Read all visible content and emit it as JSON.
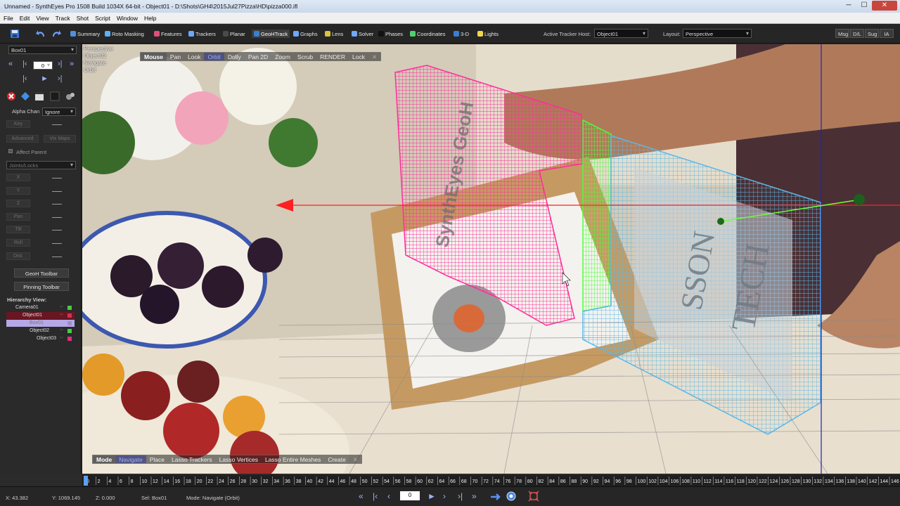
{
  "window": {
    "title": "Unnamed - SynthEyes Pro 1508 Build 1034X 64-bit - Object01 - D:\\Shots\\GH4\\2015Jul27Pizza\\HD\\pizza000.ifl",
    "minimize": "─",
    "maximize": "☐",
    "close": "✕"
  },
  "menu": [
    "File",
    "Edit",
    "View",
    "Track",
    "Shot",
    "Script",
    "Window",
    "Help"
  ],
  "toolbar": {
    "rooms": [
      {
        "label": "Summary",
        "icon": "summary-icon",
        "color": "#4f8fe0"
      },
      {
        "label": "Roto Masking",
        "icon": "roto-icon",
        "color": "#5bb0ff"
      },
      {
        "label": "Features",
        "icon": "features-icon",
        "color": "#e04f7a"
      },
      {
        "label": "Trackers",
        "icon": "trackers-icon",
        "color": "#6fa8ff"
      },
      {
        "label": "Planar",
        "icon": "planar-icon",
        "color": "#4a4a4a"
      },
      {
        "label": "GeoHTrack",
        "icon": "geohtrack-icon",
        "color": "#3a7fd0"
      },
      {
        "label": "Graphs",
        "icon": "graphs-icon",
        "color": "#6fa8ff"
      },
      {
        "label": "Lens",
        "icon": "lens-icon",
        "color": "#d9c43a"
      },
      {
        "label": "Solver",
        "icon": "solver-icon",
        "color": "#6fa8ff"
      },
      {
        "label": "Phases",
        "icon": "phases-icon",
        "color": "#111111"
      },
      {
        "label": "Coordinates",
        "icon": "coordinates-icon",
        "color": "#4fd06e"
      },
      {
        "label": "3-D",
        "icon": "3d-icon",
        "color": "#3a7fd0"
      },
      {
        "label": "Lights",
        "icon": "lights-icon",
        "color": "#f0d84a"
      }
    ],
    "active_room": "GeoHTrack",
    "tracker_host_label": "Active Tracker Host:",
    "tracker_host_value": "Object01",
    "layout_label": "Layout:",
    "layout_value": "Perspective",
    "buttons": [
      "Msg",
      "D/L",
      "Sug",
      "IA"
    ]
  },
  "left_panel": {
    "object_select": "Box01",
    "frame_value": "0",
    "alpha_label": "Alpha Chan",
    "alpha_value": "Ignore",
    "key_label": "Key",
    "advanced_label": "Advanced",
    "vtx_maps_label": "Vtx Maps",
    "affect_parent_label": "Affect Parent",
    "joints_label": "Joints/Locks",
    "axes": [
      "X",
      "Y",
      "Z",
      "Pan",
      "Tilt",
      "Roll",
      "Dist."
    ],
    "geoh_toolbar": "GeoH Toolbar",
    "pinning_toolbar": "Pinning Toolbar",
    "hierarchy_label": "Hierarchy View:",
    "hierarchy": [
      {
        "name": "Camera01",
        "color": "#44cc44",
        "style": "normal"
      },
      {
        "name": "Object01",
        "color": "#cc3355",
        "style": "selected-parent"
      },
      {
        "name": "Box01",
        "color": "#9a8fd0",
        "style": "selected"
      },
      {
        "name": "Object02",
        "color": "#44cc44",
        "style": "normal"
      },
      {
        "name": "Object03",
        "color": "#e0307a",
        "style": "normal"
      }
    ]
  },
  "viewport": {
    "info": [
      "Perspective",
      "Object02",
      "Navigate",
      "Orbit"
    ],
    "mouse_menu": {
      "head": "Mouse",
      "items": [
        "Pan",
        "Look",
        "Orbit",
        "Dolly",
        "Pan 2D",
        "Zoom",
        "Scrub",
        "RENDER",
        "Lock"
      ],
      "selected": "Orbit",
      "close": "✕"
    },
    "mode_menu": {
      "head": "Mode",
      "items": [
        "Navigate",
        "Place",
        "Lasso Trackers",
        "Lasso Vertices",
        "Lasso Entire Meshes",
        "Create"
      ],
      "selected": "Navigate",
      "close": "✕"
    },
    "mesh_text_pink": "SynthEyes GeoH",
    "mesh_text_box": [
      "SSON",
      "TECH"
    ],
    "colors": {
      "pink_mesh": "#ff2d9b",
      "green_mesh": "#4dff3a",
      "blue_mesh": "#5ab8e8",
      "axis_red": "#ff2020",
      "axis_blue": "#2020c8"
    }
  },
  "timeline": {
    "start": 0,
    "end": 146,
    "step": 2,
    "current": 0
  },
  "status": {
    "x": "X: 43.382",
    "y": "Y: 1069.145",
    "z": "Z: 0.000",
    "selection": "Sel: Box01",
    "mode": "Mode: Navigate (Orbit)",
    "frame": "0"
  }
}
